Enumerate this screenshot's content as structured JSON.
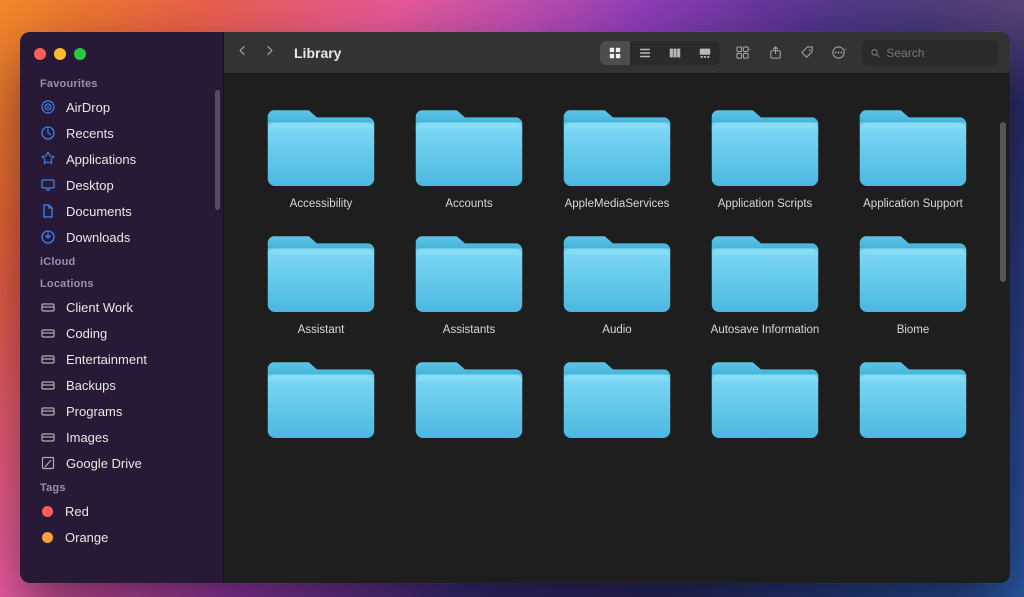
{
  "window": {
    "title": "Library"
  },
  "sidebar": {
    "sections": {
      "favourites": {
        "label": "Favourites",
        "items": [
          {
            "label": "AirDrop",
            "icon": "airdrop"
          },
          {
            "label": "Recents",
            "icon": "clock"
          },
          {
            "label": "Applications",
            "icon": "apps"
          },
          {
            "label": "Desktop",
            "icon": "desktop"
          },
          {
            "label": "Documents",
            "icon": "document"
          },
          {
            "label": "Downloads",
            "icon": "download"
          }
        ]
      },
      "icloud": {
        "label": "iCloud",
        "items": []
      },
      "locations": {
        "label": "Locations",
        "items": [
          {
            "label": "Client Work",
            "icon": "drive"
          },
          {
            "label": "Coding",
            "icon": "drive"
          },
          {
            "label": "Entertainment",
            "icon": "drive"
          },
          {
            "label": "Backups",
            "icon": "drive"
          },
          {
            "label": "Programs",
            "icon": "drive"
          },
          {
            "label": "Images",
            "icon": "drive"
          },
          {
            "label": "Google Drive",
            "icon": "gdrive"
          }
        ]
      },
      "tags": {
        "label": "Tags",
        "items": [
          {
            "label": "Red",
            "color": "#ff5c5c"
          },
          {
            "label": "Orange",
            "color": "#ff9f3b"
          }
        ]
      }
    }
  },
  "toolbar": {
    "view_mode": "icon",
    "search_placeholder": "Search"
  },
  "folders": [
    "Accessibility",
    "Accounts",
    "AppleMediaServices",
    "Application Scripts",
    "Application Support",
    "Assistant",
    "Assistants",
    "Audio",
    "Autosave Information",
    "Biome",
    "",
    "",
    "",
    "",
    ""
  ],
  "colors": {
    "folder_light": "#6bd3f2",
    "folder_dark": "#3fb5de",
    "accent": "#3b82f6"
  }
}
